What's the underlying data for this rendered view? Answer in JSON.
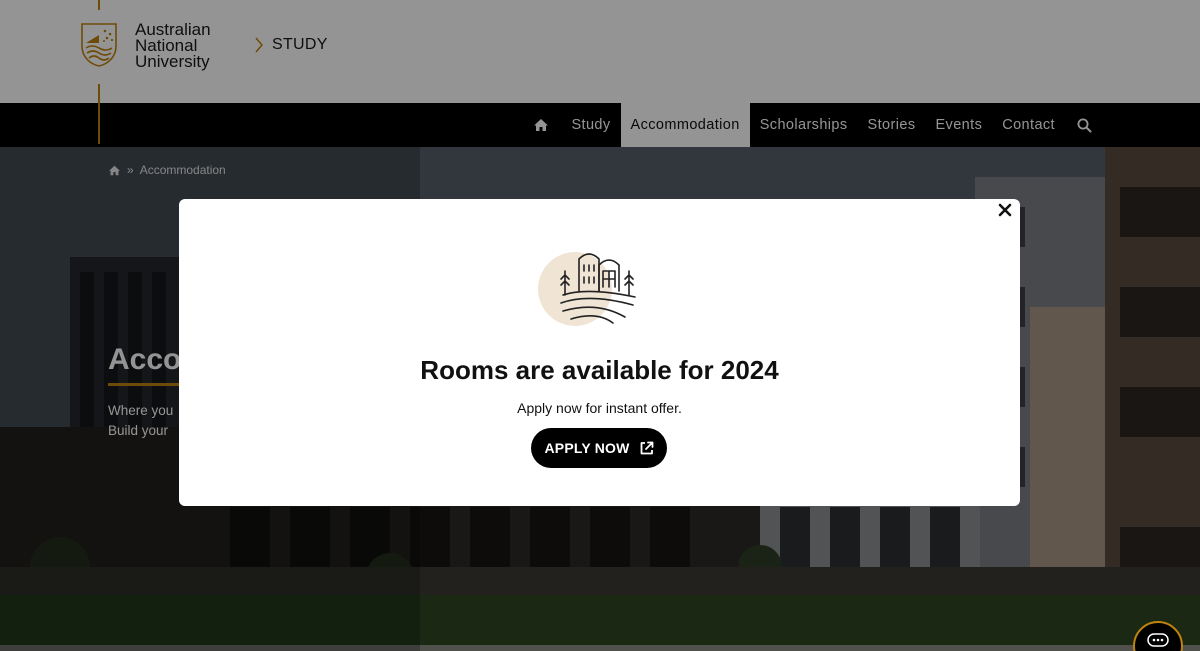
{
  "header": {
    "logo_lines": [
      "Australian",
      "National",
      "University"
    ],
    "section_label": "STUDY"
  },
  "nav": {
    "items": [
      {
        "label": "Study",
        "active": false
      },
      {
        "label": "Accommodation",
        "active": true
      },
      {
        "label": "Scholarships",
        "active": false
      },
      {
        "label": "Stories",
        "active": false
      },
      {
        "label": "Events",
        "active": false
      },
      {
        "label": "Contact",
        "active": false
      }
    ],
    "icons": {
      "home": "home-icon",
      "search": "search-icon"
    }
  },
  "hero": {
    "breadcrumb": {
      "separator": "»",
      "current": "Accommodation"
    },
    "title_partial": "Acco",
    "line1_partial": "Where you",
    "line2_partial": "Build your"
  },
  "modal": {
    "title": "Rooms are available for 2024",
    "subtitle": "Apply now for instant offer.",
    "button_label": "APPLY NOW",
    "icons": {
      "close": "close-icon",
      "illustration": "campus-buildings-icon",
      "external": "external-link-icon"
    }
  },
  "colors": {
    "accent_gold": "#be830e",
    "nav_bg": "#000000",
    "illustration_circle": "#f0e4d4"
  }
}
